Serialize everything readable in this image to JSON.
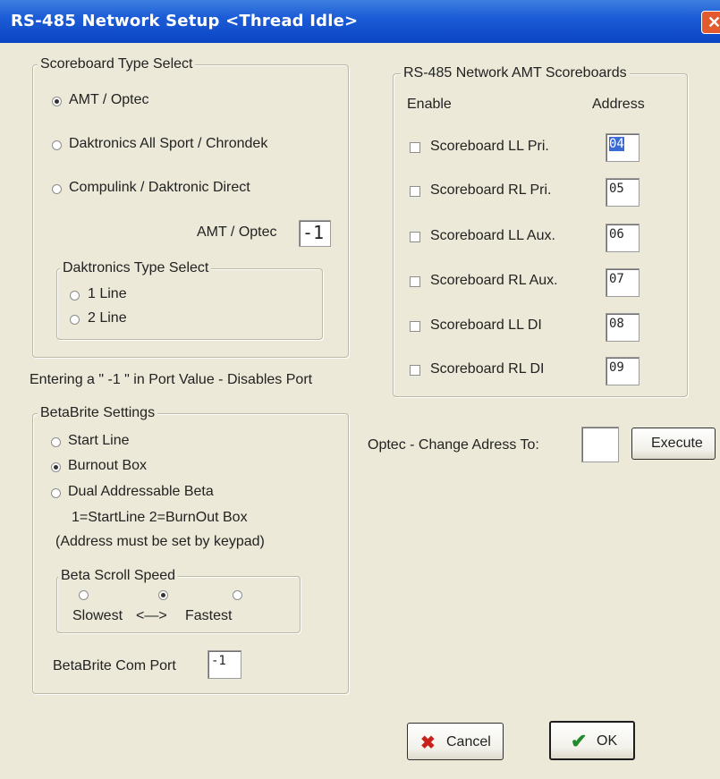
{
  "window": {
    "title": "RS-485 Network Setup <Thread Idle>"
  },
  "scoreboard_type": {
    "legend": "Scoreboard Type Select",
    "options": [
      {
        "label": "AMT / Optec",
        "checked": true
      },
      {
        "label": "Daktronics All Sport / Chrondek",
        "checked": false
      },
      {
        "label": "Compulink / Daktronic Direct",
        "checked": false
      }
    ],
    "amt_label": "AMT / Optec",
    "amt_value": "-1",
    "daktronics": {
      "legend": "Daktronics Type Select",
      "options": [
        {
          "label": "1 Line",
          "checked": false
        },
        {
          "label": "2 Line",
          "checked": false
        }
      ]
    }
  },
  "port_note": "Entering a \" -1 \" in Port Value - Disables Port",
  "betabrite": {
    "legend": "BetaBrite Settings",
    "options": [
      {
        "label": "Start Line",
        "checked": false
      },
      {
        "label": "Burnout Box",
        "checked": true
      },
      {
        "label": "Dual Addressable Beta",
        "checked": false
      }
    ],
    "note1": "1=StartLine  2=BurnOut Box",
    "note2": "(Address must be set by keypad)",
    "scroll": {
      "legend": "Beta Scroll Speed",
      "selected_index": 1,
      "slowest": "Slowest",
      "arrow": "<—>",
      "fastest": "Fastest"
    },
    "com_port_label": "BetaBrite Com Port",
    "com_port_value": "-1"
  },
  "network": {
    "legend": "RS-485 Network AMT Scoreboards",
    "enable_header": "Enable",
    "address_header": "Address",
    "rows": [
      {
        "label": "Scoreboard LL Pri.",
        "address": "04",
        "enabled": false
      },
      {
        "label": "Scoreboard RL Pri.",
        "address": "05",
        "enabled": false
      },
      {
        "label": "Scoreboard LL Aux.",
        "address": "06",
        "enabled": false
      },
      {
        "label": "Scoreboard RL Aux.",
        "address": "07",
        "enabled": false
      },
      {
        "label": "Scoreboard LL DI",
        "address": "08",
        "enabled": false
      },
      {
        "label": "Scoreboard RL DI",
        "address": "09",
        "enabled": false
      }
    ]
  },
  "optec": {
    "label": "Optec - Change Adress To:",
    "value": "",
    "execute_label": "Execute"
  },
  "buttons": {
    "cancel_label": "Cancel",
    "ok_label": "OK"
  },
  "colors": {
    "titlebar": "#0b45c4",
    "dialog_bg": "#ece9d8",
    "cancel_icon": "#c8201a",
    "ok_icon": "#1f8a2a",
    "selection": "#3a6ad6"
  }
}
